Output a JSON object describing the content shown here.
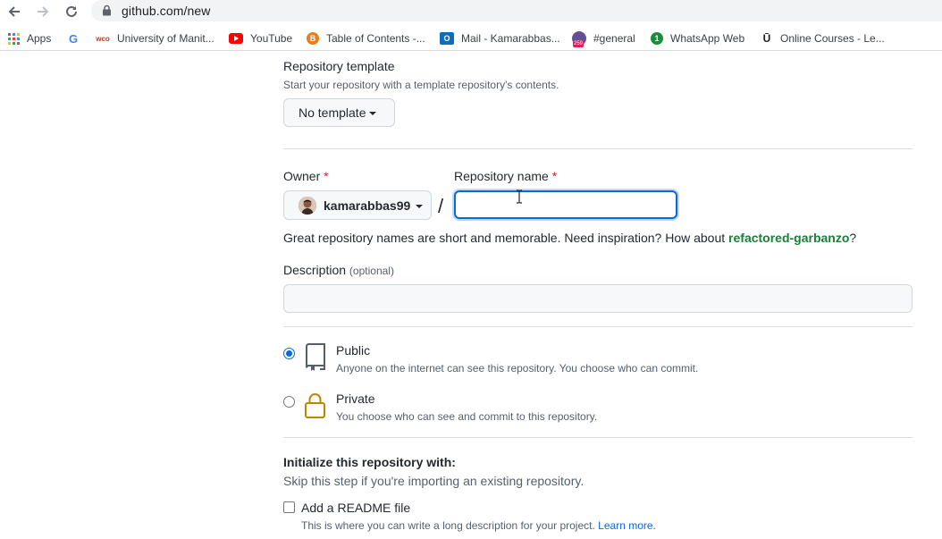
{
  "browser": {
    "url": "github.com/new",
    "bookmarks": [
      {
        "label": "Apps",
        "icon": "apps-grid-icon"
      },
      {
        "label": "",
        "icon": "google-icon"
      },
      {
        "label": "University of Manit...",
        "icon": "wco-icon",
        "icon_text": "wco"
      },
      {
        "label": "YouTube",
        "icon": "youtube-icon"
      },
      {
        "label": "Table of Contents -...",
        "icon": "b-circle-icon",
        "icon_text": "B"
      },
      {
        "label": "Mail - Kamarabbas...",
        "icon": "outlook-icon",
        "icon_text": "O"
      },
      {
        "label": "#general",
        "icon": "slack-icon",
        "icon_text": "259"
      },
      {
        "label": "WhatsApp Web",
        "icon": "whatsapp-icon",
        "icon_text": "1"
      },
      {
        "label": "Online Courses - Le...",
        "icon": "udemy-icon",
        "icon_text": "Ū"
      }
    ]
  },
  "form": {
    "template": {
      "heading": "Repository template",
      "help": "Start your repository with a template repository's contents.",
      "button_label": "No template"
    },
    "owner": {
      "label": "Owner",
      "required_mark": "*",
      "value": "kamarabbas99"
    },
    "separator": "/",
    "repo_name": {
      "label": "Repository name",
      "required_mark": "*",
      "value": ""
    },
    "suggestion": {
      "text": "Great repository names are short and memorable. Need inspiration? How about",
      "name": "refactored-garbanzo",
      "suffix": "?"
    },
    "description": {
      "label": "Description",
      "optional": "(optional)",
      "value": ""
    },
    "visibility": {
      "selected": "public",
      "public": {
        "title": "Public",
        "help": "Anyone on the internet can see this repository. You choose who can commit."
      },
      "private": {
        "title": "Private",
        "help": "You choose who can see and commit to this repository."
      }
    },
    "init": {
      "heading": "Initialize this repository with:",
      "help": "Skip this step if you're importing an existing repository.",
      "readme": {
        "label": "Add a README file",
        "help": "This is where you can write a long description for your project.",
        "link": "Learn more.",
        "checked": false
      }
    }
  },
  "colors": {
    "accent": "#0969da",
    "link_green": "#1a7f37",
    "required": "#cf222e"
  }
}
